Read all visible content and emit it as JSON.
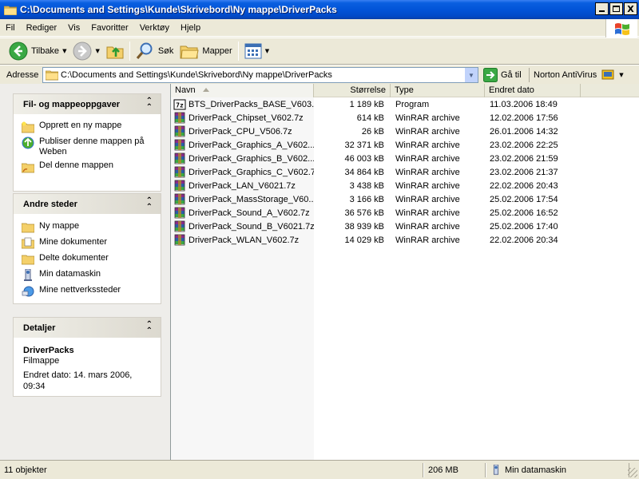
{
  "window": {
    "title": "C:\\Documents and Settings\\Kunde\\Skrivebord\\Ny mappe\\DriverPacks",
    "close_glyph": "X"
  },
  "menu": [
    "Fil",
    "Rediger",
    "Vis",
    "Favoritter",
    "Verktøy",
    "Hjelp"
  ],
  "toolbar": {
    "back_label": "Tilbake",
    "search_label": "Søk",
    "folders_label": "Mapper"
  },
  "address": {
    "label": "Adresse",
    "value": "C:\\Documents and Settings\\Kunde\\Skrivebord\\Ny mappe\\DriverPacks",
    "go_label": "Gå til",
    "norton_label": "Norton AntiVirus"
  },
  "tasks": {
    "title": "Fil- og mappeoppgaver",
    "items": [
      "Opprett en ny mappe",
      "Publiser denne mappen på Weben",
      "Del denne mappen"
    ]
  },
  "places": {
    "title": "Andre steder",
    "items": [
      "Ny mappe",
      "Mine dokumenter",
      "Delte dokumenter",
      "Min datamaskin",
      "Mine nettverkssteder"
    ]
  },
  "details": {
    "title": "Detaljer",
    "name": "DriverPacks",
    "kind": "Filmappe",
    "modified_line1": "Endret dato: 14. mars 2006,",
    "modified_line2": "09:34"
  },
  "columns": [
    "Navn",
    "Størrelse",
    "Type",
    "Endret dato"
  ],
  "files": [
    {
      "name": "BTS_DriverPacks_BASE_V603...",
      "size": "1 189 kB",
      "type": "Program",
      "date": "11.03.2006 18:49",
      "icon": "7z-exe-icon"
    },
    {
      "name": "DriverPack_Chipset_V602.7z",
      "size": "614 kB",
      "type": "WinRAR archive",
      "date": "12.02.2006 17:56",
      "icon": "winrar-icon"
    },
    {
      "name": "DriverPack_CPU_V506.7z",
      "size": "26 kB",
      "type": "WinRAR archive",
      "date": "26.01.2006 14:32",
      "icon": "winrar-icon"
    },
    {
      "name": "DriverPack_Graphics_A_V602...",
      "size": "32 371 kB",
      "type": "WinRAR archive",
      "date": "23.02.2006 22:25",
      "icon": "winrar-icon"
    },
    {
      "name": "DriverPack_Graphics_B_V602...",
      "size": "46 003 kB",
      "type": "WinRAR archive",
      "date": "23.02.2006 21:59",
      "icon": "winrar-icon"
    },
    {
      "name": "DriverPack_Graphics_C_V602.7z",
      "size": "34 864 kB",
      "type": "WinRAR archive",
      "date": "23.02.2006 21:37",
      "icon": "winrar-icon"
    },
    {
      "name": "DriverPack_LAN_V6021.7z",
      "size": "3 438 kB",
      "type": "WinRAR archive",
      "date": "22.02.2006 20:43",
      "icon": "winrar-icon"
    },
    {
      "name": "DriverPack_MassStorage_V60...",
      "size": "3 166 kB",
      "type": "WinRAR archive",
      "date": "25.02.2006 17:54",
      "icon": "winrar-icon"
    },
    {
      "name": "DriverPack_Sound_A_V602.7z",
      "size": "36 576 kB",
      "type": "WinRAR archive",
      "date": "25.02.2006 16:52",
      "icon": "winrar-icon"
    },
    {
      "name": "DriverPack_Sound_B_V6021.7z",
      "size": "38 939 kB",
      "type": "WinRAR archive",
      "date": "25.02.2006 17:40",
      "icon": "winrar-icon"
    },
    {
      "name": "DriverPack_WLAN_V602.7z",
      "size": "14 029 kB",
      "type": "WinRAR archive",
      "date": "22.02.2006 20:34",
      "icon": "winrar-icon"
    }
  ],
  "status": {
    "count": "11 objekter",
    "size": "206 MB",
    "location": "Min datamaskin"
  }
}
